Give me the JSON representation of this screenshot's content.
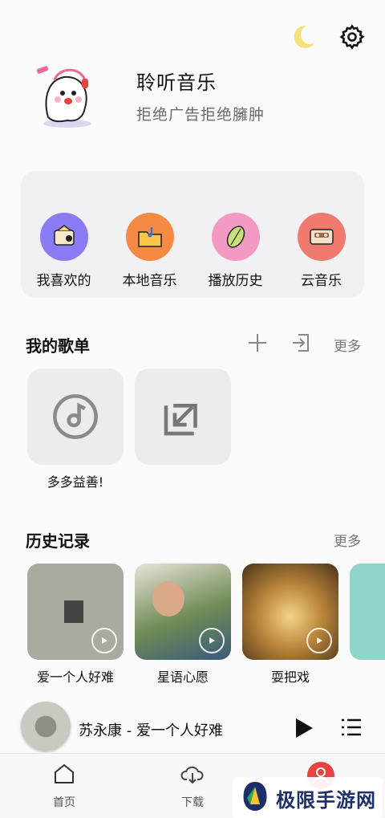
{
  "header": {
    "app_name": "聆听音乐",
    "slogan": "拒绝广告拒绝臃肿"
  },
  "quick_actions": [
    {
      "label": "我喜欢的",
      "icon": "favorites-icon",
      "color": "#8a7cf5"
    },
    {
      "label": "本地音乐",
      "icon": "folder-music-icon",
      "color": "#f58a45"
    },
    {
      "label": "播放历史",
      "icon": "history-leaf-icon",
      "color": "#f29ac3"
    },
    {
      "label": "云音乐",
      "icon": "cassette-icon",
      "color": "#f07a6e"
    }
  ],
  "playlists": {
    "title": "我的歌单",
    "more": "更多",
    "items": [
      {
        "name": "多多益善!"
      }
    ]
  },
  "history": {
    "title": "历史记录",
    "more": "更多",
    "items": [
      {
        "name": "爱一个人好难",
        "cover_color": "#a9aba1"
      },
      {
        "name": "星语心愿",
        "cover_color": "#5c7a4a"
      },
      {
        "name": "耍把戏",
        "cover_color": "#b9853a"
      },
      {
        "name": "",
        "cover_color": "#8fd6c8"
      }
    ]
  },
  "player": {
    "now_playing": "苏永康 - 爱一个人好难"
  },
  "tabs": [
    {
      "label": "首页"
    },
    {
      "label": "下载"
    }
  ],
  "watermark": {
    "text": "极限手游网"
  },
  "colors": {
    "accent_red": "#e8433f",
    "moon_yellow": "#f4e27a"
  }
}
